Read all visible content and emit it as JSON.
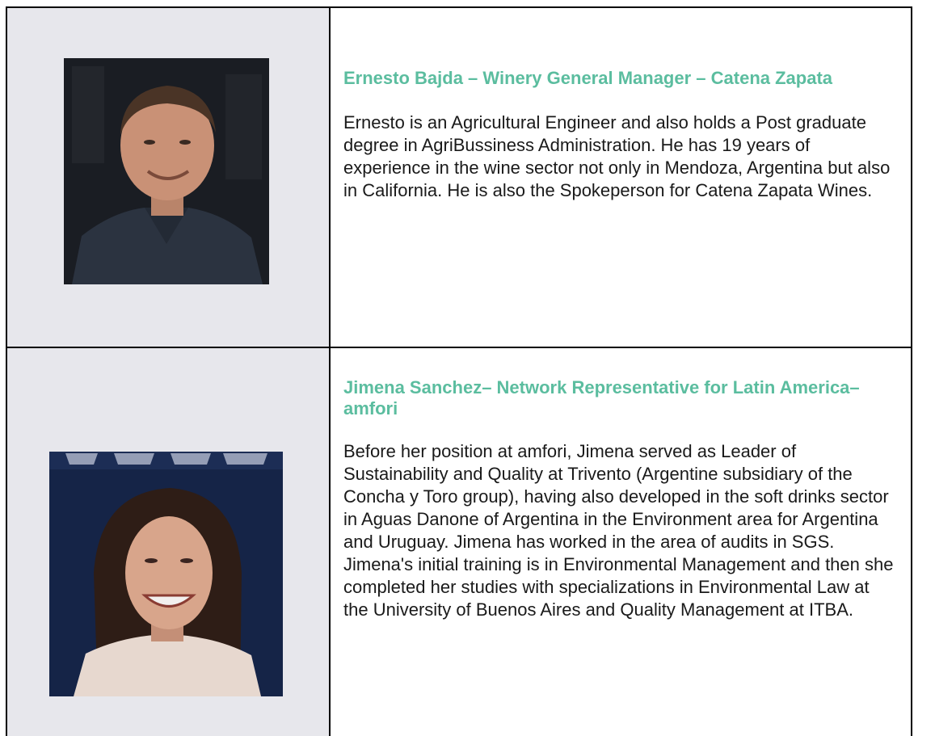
{
  "speakers": [
    {
      "heading": "Ernesto Bajda – Winery General Manager – Catena Zapata",
      "bio": "Ernesto is an Agricultural Engineer and also holds a Post graduate degree in AgriBussiness Administration.  He has 19 years of experience in the wine sector not only in Mendoza, Argentina but also in California. He is also the Spokeperson for Catena Zapata Wines."
    },
    {
      "heading": "Jimena Sanchez– Network Representative for Latin America– amfori",
      "bio": "Before her position at amfori, Jimena served as Leader of Sustainability and Quality at Trivento (Argentine subsidiary of the Concha y Toro group), having also developed in the soft drinks sector in Aguas Danone of Argentina in the Environment area for Argentina and Uruguay. Jimena has worked in the area of audits in SGS. Jimena's initial training is in Environmental Management and then she completed her studies with specializations in Environmental Law at the University of Buenos Aires and Quality Management at ITBA."
    }
  ],
  "colors": {
    "heading": "#5bbd9f",
    "photo_cell_background": "#e7e7ec",
    "border": "#000000"
  }
}
